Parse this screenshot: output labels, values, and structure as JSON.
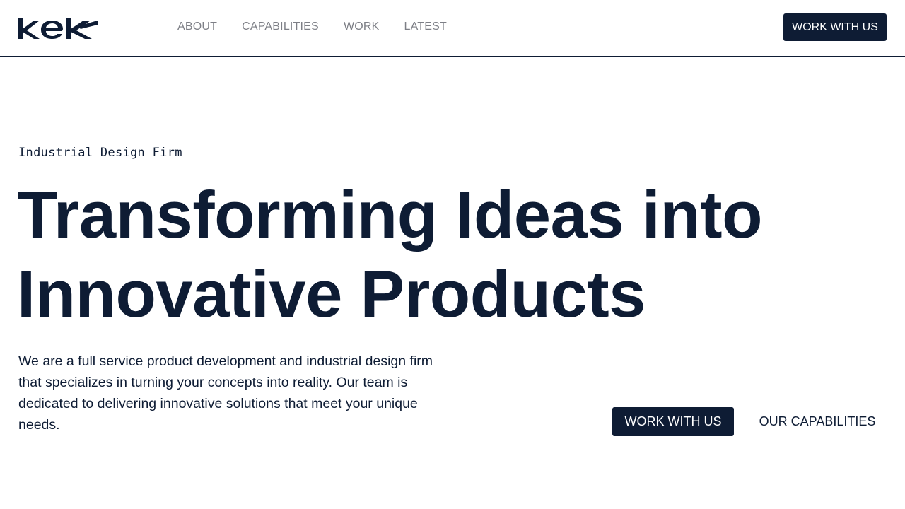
{
  "header": {
    "logo_text": "kek",
    "nav": [
      {
        "label": "ABOUT"
      },
      {
        "label": "CAPABILITIES"
      },
      {
        "label": "WORK"
      },
      {
        "label": "LATEST"
      }
    ],
    "cta_label": "WORK WITH US"
  },
  "hero": {
    "eyebrow": "Industrial Design Firm",
    "headline_line1": "Transforming Ideas into",
    "headline_line2": "Innovative Products",
    "intro": "We are a full service product development and industrial design firm that specializes in turning your concepts into reality. Our team is dedicated to delivering innovative solutions that meet your unique needs.",
    "primary_cta": "WORK WITH US",
    "secondary_cta": "OUR CAPABILITIES"
  },
  "colors": {
    "navy": "#0e1c34",
    "nav_gray": "#7d7f86",
    "background": "#ffffff"
  }
}
